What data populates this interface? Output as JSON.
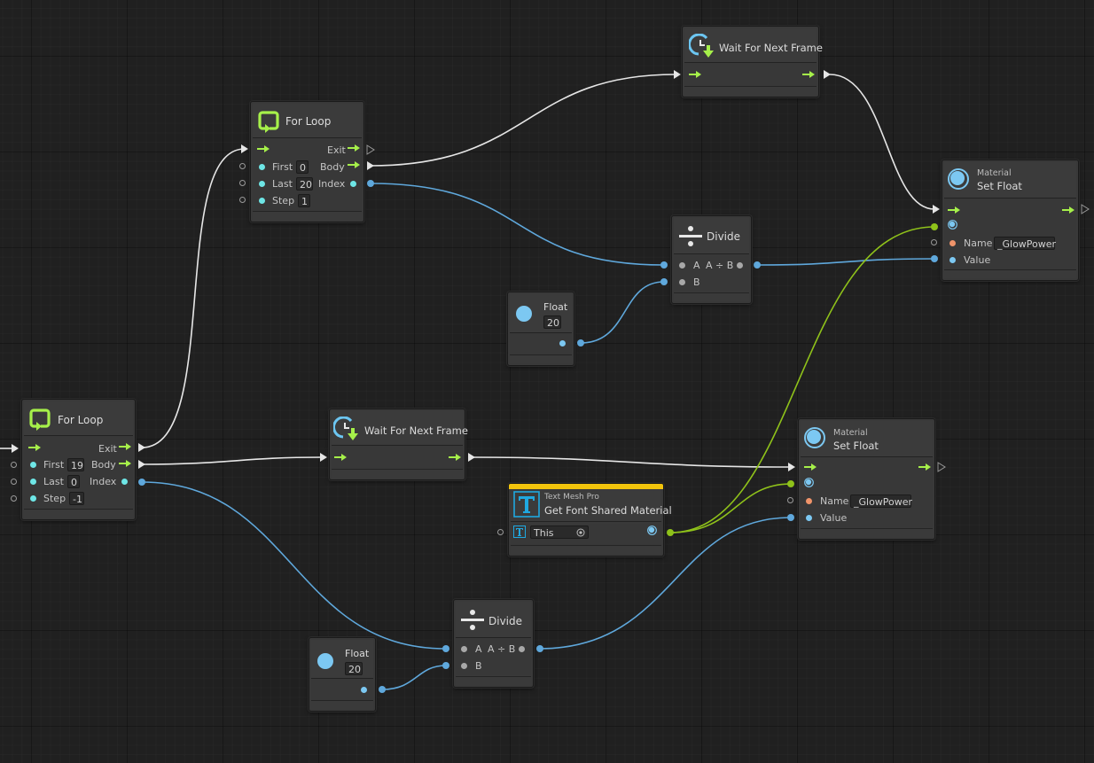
{
  "colors": {
    "background": "#202020",
    "flow_wire": "#e8e8e8",
    "float_wire": "#5fa8dc",
    "material_wire": "#8fc21a",
    "flow_arrow": "#a6f04a",
    "float_port": "#7cc8f2",
    "int_port": "#6ee6e6",
    "string_port": "#f0946a",
    "textmeshpro_accent": "#f2c40c"
  },
  "nodes": {
    "for_loop_top": {
      "title": "For Loop",
      "icon": "loop-icon",
      "inputs": [
        {
          "label": "First",
          "value": "0"
        },
        {
          "label": "Last",
          "value": "20"
        },
        {
          "label": "Step",
          "value": "1"
        }
      ],
      "outputs": {
        "exit": "Exit",
        "body": "Body",
        "index": "Index"
      }
    },
    "for_loop_bottom": {
      "title": "For Loop",
      "icon": "loop-icon",
      "inputs": [
        {
          "label": "First",
          "value": "19"
        },
        {
          "label": "Last",
          "value": "0"
        },
        {
          "label": "Step",
          "value": "-1"
        }
      ],
      "outputs": {
        "exit": "Exit",
        "body": "Body",
        "index": "Index"
      }
    },
    "wait_top": {
      "title": "Wait For Next Frame",
      "icon": "clock-down-icon"
    },
    "wait_bottom": {
      "title": "Wait For Next Frame",
      "icon": "clock-down-icon"
    },
    "set_float_top": {
      "category": "Material",
      "title": "Set Float",
      "icon": "material-sphere-icon",
      "name_label": "Name",
      "name_value": "_GlowPower",
      "value_label": "Value"
    },
    "set_float_bottom": {
      "category": "Material",
      "title": "Set Float",
      "icon": "material-sphere-icon",
      "name_label": "Name",
      "name_value": "_GlowPower",
      "value_label": "Value"
    },
    "divide_top": {
      "title": "Divide",
      "icon": "divide-icon",
      "a_label": "A",
      "b_label": "B",
      "out_label": "A ÷ B"
    },
    "divide_bottom": {
      "title": "Divide",
      "icon": "divide-icon",
      "a_label": "A",
      "b_label": "B",
      "out_label": "A ÷ B"
    },
    "float_top": {
      "title": "Float",
      "value": "20",
      "icon": "float-circle-icon"
    },
    "float_bottom": {
      "title": "Float",
      "value": "20",
      "icon": "float-circle-icon"
    },
    "get_font_material": {
      "category": "Text Mesh Pro",
      "title": "Get Font Shared Material",
      "icon": "textmeshpro-t-icon",
      "target_value": "This"
    }
  }
}
